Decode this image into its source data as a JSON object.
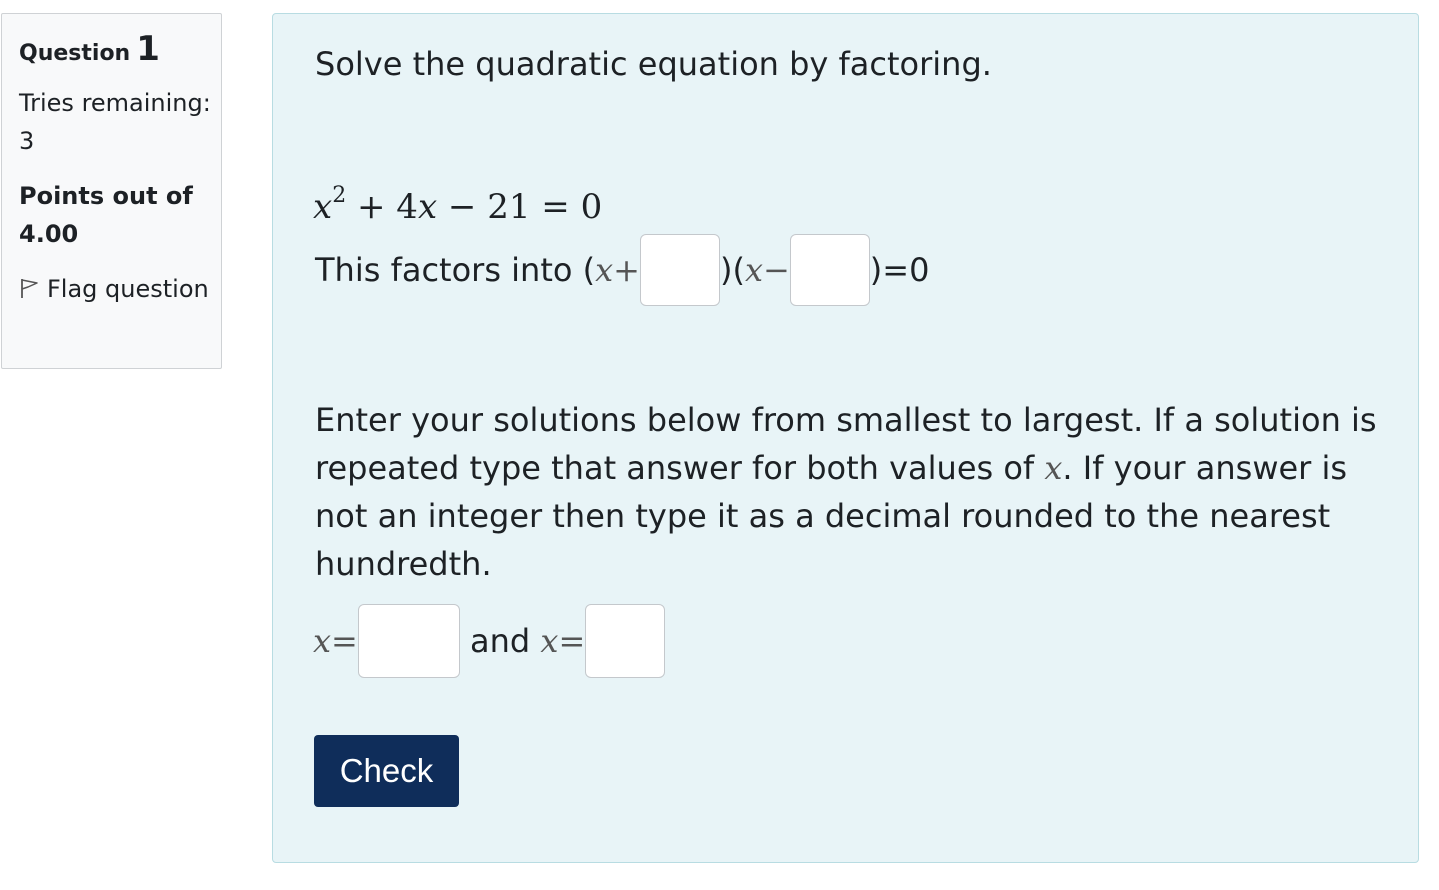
{
  "question_info": {
    "question_label": "Question",
    "question_number": "1",
    "tries_remaining": "Tries remaining: 3",
    "points": "Points out of 4.00",
    "flag_label": "Flag question"
  },
  "question": {
    "prompt": "Solve the quadratic equation by factoring.",
    "equation": {
      "var": "x",
      "exp": "2",
      "rest": " + 4",
      "var2": "x",
      "tail": " − 21 = 0"
    },
    "factor": {
      "lead_text": "This factors into (",
      "x1": "x",
      "plus": "+",
      "mid": ")(",
      "x2": "x",
      "minus": "−",
      "end": ")=0",
      "blank1_value": "",
      "blank2_value": ""
    },
    "instructions_part1": "Enter your solutions below from smallest to largest. If a solution is repeated type that answer for both values of ",
    "instructions_var": "x",
    "instructions_part2": ". If your answer is not an integer then type it as a decimal rounded to the nearest hundredth.",
    "solution": {
      "x_label_1": "x",
      "eq_sign_1": " =",
      "and_text": " and ",
      "x_label_2": "x",
      "eq_sign_2": " =",
      "answer1_value": "",
      "answer2_value": ""
    },
    "check_label": "Check"
  }
}
